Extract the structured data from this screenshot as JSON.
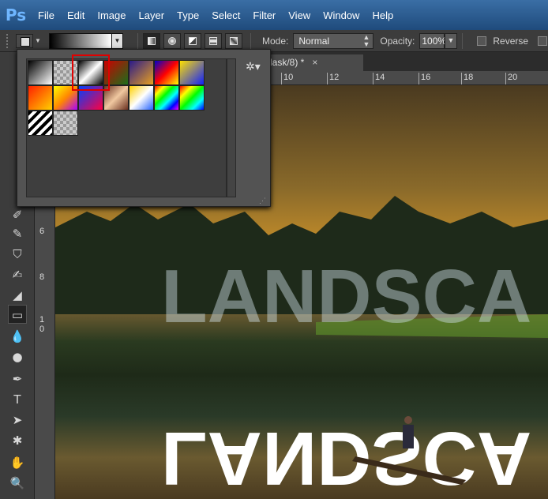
{
  "app": {
    "logo": "Ps"
  },
  "menu": [
    "File",
    "Edit",
    "Image",
    "Layer",
    "Type",
    "Select",
    "Filter",
    "View",
    "Window",
    "Help"
  ],
  "options": {
    "mode_label": "Mode:",
    "mode_value": "Normal",
    "opacity_label": "Opacity:",
    "opacity_value": "100%",
    "reverse_label": "Reverse"
  },
  "document": {
    "tab_label": "lask/8) *",
    "close_symbol": "×"
  },
  "ruler": {
    "horizontal": [
      "10",
      "12",
      "14",
      "16",
      "18",
      "20"
    ],
    "vertical": [
      "6",
      "8",
      "1",
      "0"
    ]
  },
  "canvas": {
    "text": "LANDSCA"
  },
  "gradient_panel": {
    "swatches": [
      [
        "linear-gradient(135deg,#000,#fff)",
        "repeating-conic-gradient(#999 0 25%,#ccc 0 50%) 0 0/8px 8px",
        "linear-gradient(135deg,#000,#fff,#000)",
        "linear-gradient(135deg,#cc0000,#1a6f1a)",
        "linear-gradient(135deg,#2a1a8a,#e8a020)",
        "linear-gradient(135deg,#0000cc,#ff0000,#ffff00)",
        "linear-gradient(135deg,#ffe000,#1020ff)"
      ],
      [
        "linear-gradient(135deg,#ff2000,#ffd000)",
        "linear-gradient(135deg,#ff0,#f80,#a0f)",
        "linear-gradient(135deg,#0040ff,#ff0040)",
        "linear-gradient(135deg,#6a3020,#f0c8a0,#6a3020)",
        "linear-gradient(135deg,#ffd000,#fff,#2060ff)",
        "linear-gradient(135deg,#f00,#ff0,#0f0,#0ff,#00f,#f0f)",
        "linear-gradient(135deg,#f00,#ff0,#0f0,#0ff,#00f)"
      ],
      [
        "repeating-linear-gradient(135deg,#000 0 4px,#fff 4px 8px)",
        "repeating-conic-gradient(#999 0 25%,#ccc 0 50%) 0 0/8px 8px"
      ]
    ],
    "gear_icon": "gear-icon"
  }
}
